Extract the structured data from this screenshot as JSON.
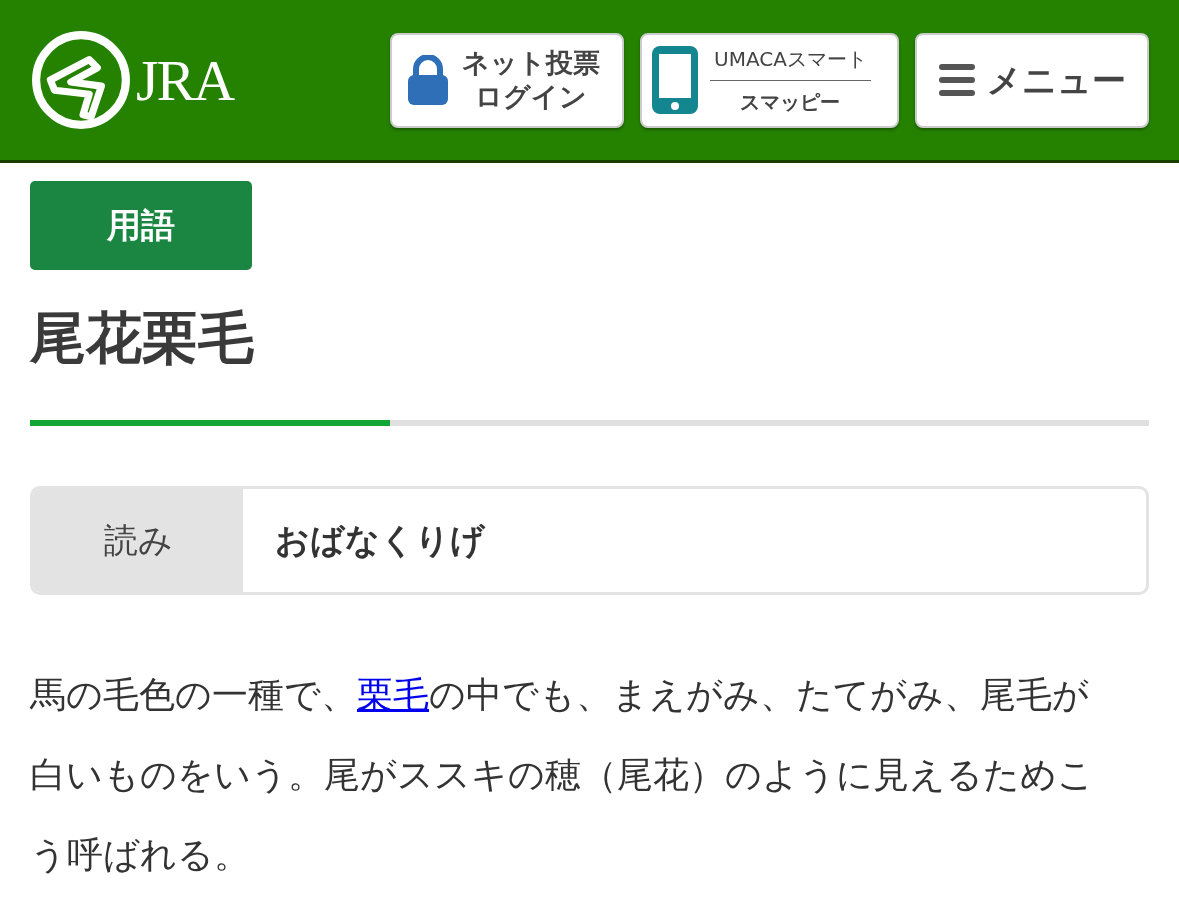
{
  "header": {
    "logo_text": "JRA",
    "buttons": [
      {
        "kind": "login",
        "lines": [
          "ネット投票",
          "ログイン"
        ]
      },
      {
        "kind": "app",
        "lines": [
          "UMACAスマート",
          "スマッピー"
        ]
      },
      {
        "kind": "menu",
        "lines": [
          "メニュー"
        ]
      }
    ]
  },
  "category": "用語",
  "title": "尾花栗毛",
  "reading": {
    "label": "読み",
    "value": "おばなくりげ"
  },
  "definition": {
    "before": "馬の毛色の一種で、",
    "link": "栗毛",
    "after": "の中でも、まえがみ、たてがみ、尾毛が白いものをいう。尾がススキの穂（尾花）のように見えるためこう呼ばれる。"
  }
}
